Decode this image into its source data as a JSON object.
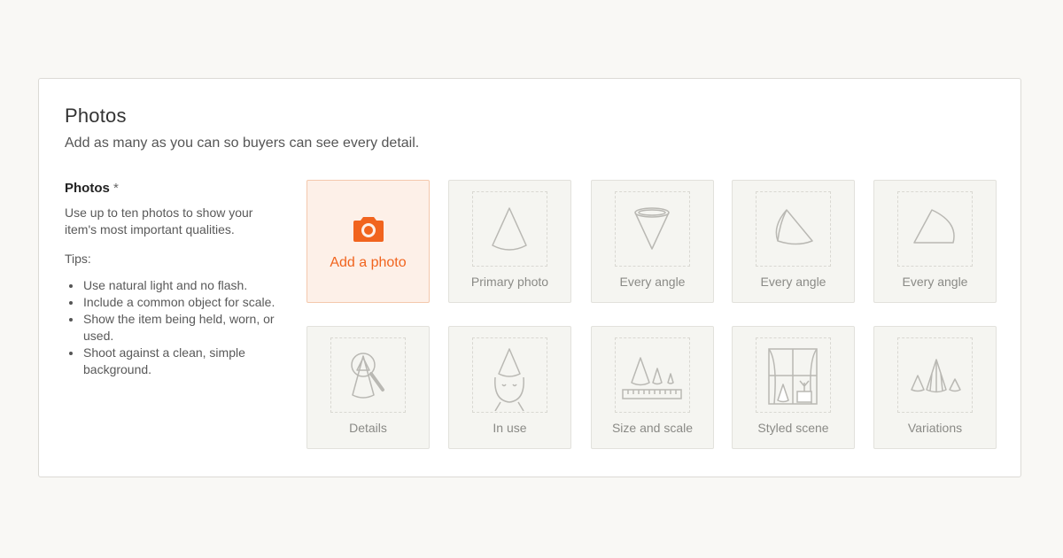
{
  "section": {
    "title": "Photos",
    "subtitle": "Add as many as you can so buyers can see every detail."
  },
  "field": {
    "label": "Photos",
    "required_mark": "*",
    "description": "Use up to ten photos to show your item's most important qualities.",
    "tips_label": "Tips:",
    "tips": [
      "Use natural light and no flash.",
      "Include a common object for scale.",
      "Show the item being held, worn, or used.",
      "Shoot against a clean, simple background."
    ]
  },
  "add_photo": {
    "label": "Add a photo",
    "icon": "camera-icon",
    "color": "#f1641e"
  },
  "slots": [
    {
      "label": "Primary photo",
      "icon": "cone-icon"
    },
    {
      "label": "Every angle",
      "icon": "cone-upside-down-icon"
    },
    {
      "label": "Every angle",
      "icon": "cone-tilted-icon"
    },
    {
      "label": "Every angle",
      "icon": "cone-side-icon"
    },
    {
      "label": "Details",
      "icon": "magnifier-cone-icon"
    },
    {
      "label": "In use",
      "icon": "cone-hat-face-icon"
    },
    {
      "label": "Size and scale",
      "icon": "cones-ruler-icon"
    },
    {
      "label": "Styled scene",
      "icon": "window-scene-icon"
    },
    {
      "label": "Variations",
      "icon": "three-cones-icon"
    }
  ]
}
